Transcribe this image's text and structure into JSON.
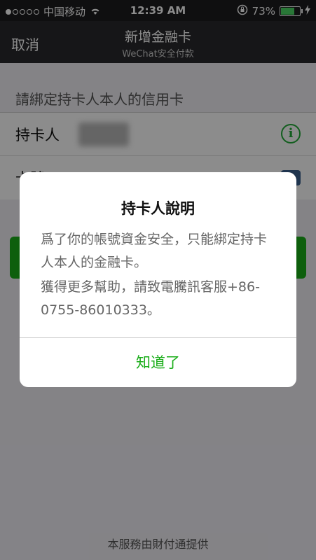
{
  "status_bar": {
    "carrier": "中国移动",
    "time": "12:39 AM",
    "battery_text": "73%",
    "battery_level": 0.73
  },
  "nav": {
    "cancel_label": "取消",
    "title": "新增金融卡",
    "subtitle": "WeChat安全付款"
  },
  "form": {
    "section_header": "請綁定持卡人本人的信用卡",
    "cardholder_label": "持卡人",
    "card_number_label": "卡號"
  },
  "footer": {
    "text": "本服務由財付通提供"
  },
  "dialog": {
    "title": "持卡人說明",
    "body_line_1": "爲了你的帳號資金安全，只能綁定持卡人本人的金融卡。",
    "body_line_2": "獲得更多幫助，請致電騰訊客服+86-0755-86010333。",
    "ok_label": "知道了"
  },
  "colors": {
    "accent_green": "#1aad19",
    "nav_bg": "#29292c"
  }
}
